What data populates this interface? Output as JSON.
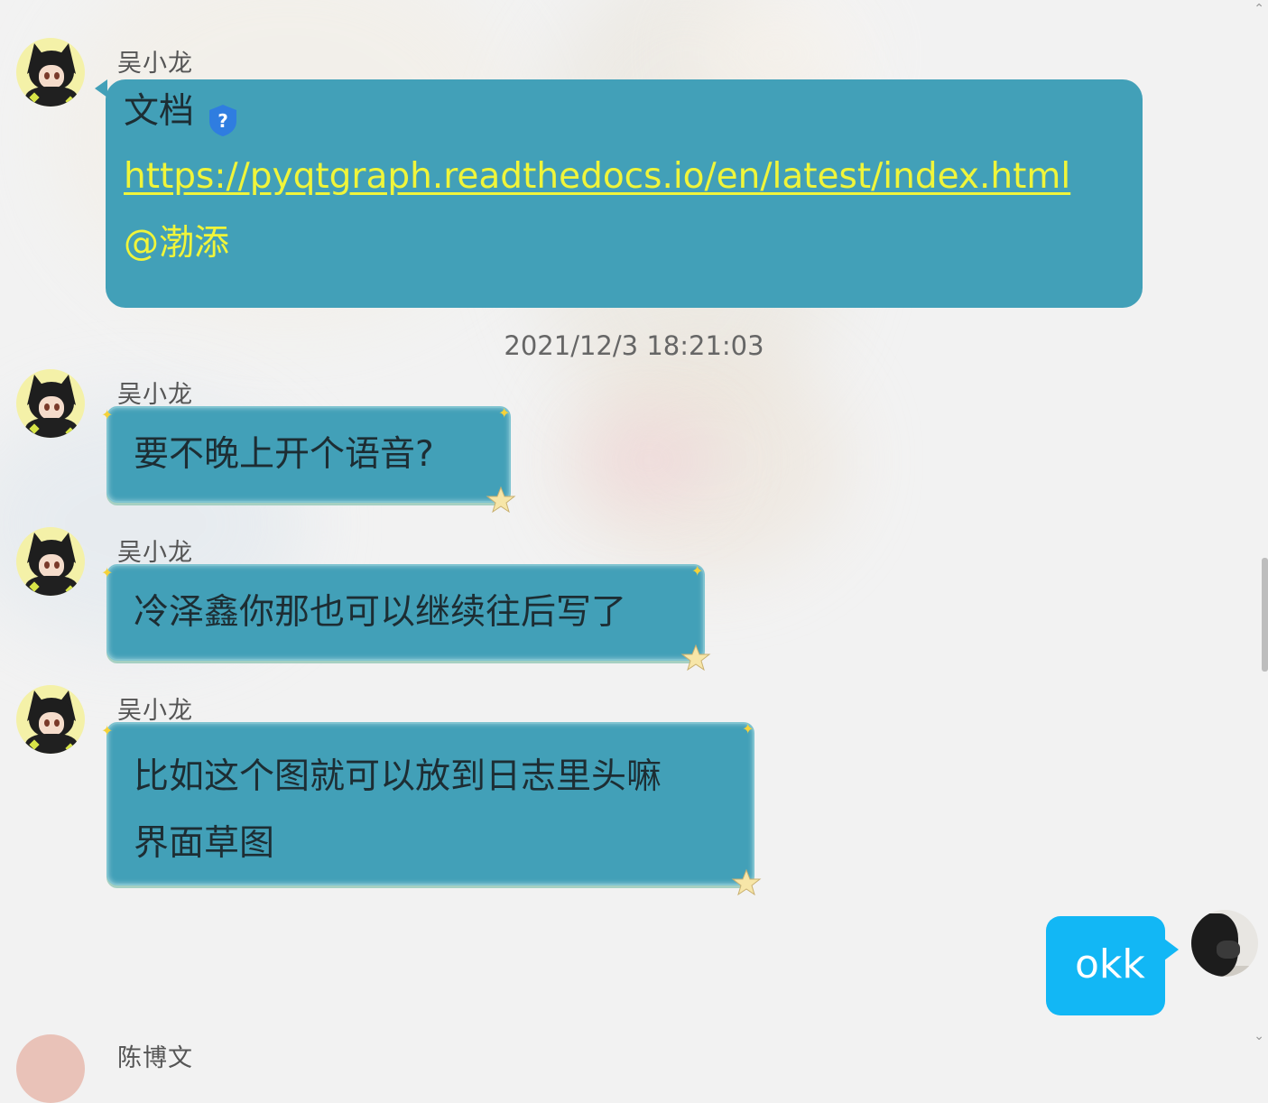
{
  "messages": [
    {
      "sender": "吴小龙",
      "line1": "文档",
      "link": "https://pyqtgraph.readthedocs.io/en/latest/index.html",
      "mention": "@渤添"
    },
    {
      "sender": "吴小龙",
      "text": "要不晚上开个语音?"
    },
    {
      "sender": "吴小龙",
      "text": "冷泽鑫你那也可以继续往后写了"
    },
    {
      "sender": "吴小龙",
      "line1": "比如这个图就可以放到日志里头嘛",
      "line2": "界面草图"
    }
  ],
  "timestamp": "2021/12/3 18:21:03",
  "my_message": {
    "text": "okk"
  },
  "partial_sender": "陈博文",
  "colors": {
    "bubble_teal": "#42a0b8",
    "my_bubble_blue": "#12b7f5",
    "link_yellow": "#f0f53a",
    "q_icon_blue": "#2f7de0"
  },
  "icons": [
    "question-badge-icon",
    "star-icon",
    "scroll-up-arrow-icon",
    "scroll-down-arrow-icon"
  ]
}
